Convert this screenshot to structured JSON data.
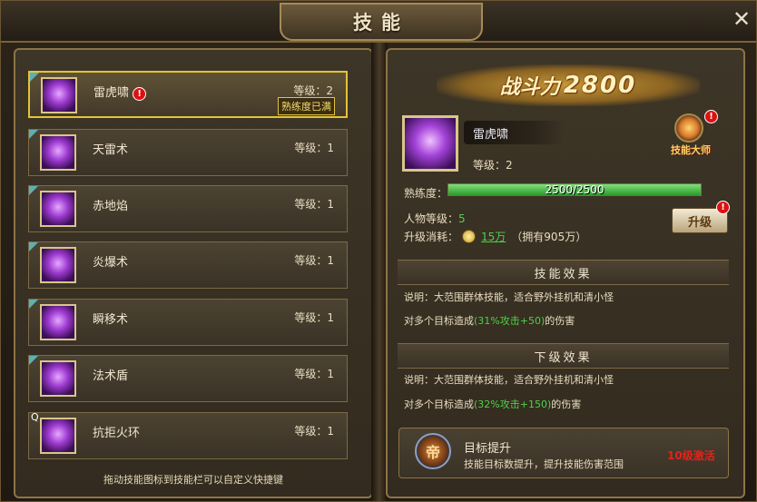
{
  "window": {
    "title": "技能",
    "close_label": "✕"
  },
  "skills": [
    {
      "name": "雷虎啸",
      "level_label": "等级：2",
      "selected": true,
      "alert": "!",
      "badge": "熟练度已满",
      "hotkey": ""
    },
    {
      "name": "天雷术",
      "level_label": "等级：1",
      "selected": false,
      "hotkey": ""
    },
    {
      "name": "赤地焰",
      "level_label": "等级：1",
      "selected": false,
      "hotkey": ""
    },
    {
      "name": "炎爆术",
      "level_label": "等级：1",
      "selected": false,
      "hotkey": ""
    },
    {
      "name": "瞬移术",
      "level_label": "等级：1",
      "selected": false,
      "hotkey": ""
    },
    {
      "name": "法术盾",
      "level_label": "等级：1",
      "selected": false,
      "hotkey": ""
    },
    {
      "name": "抗拒火环",
      "level_label": "等级：1",
      "selected": false,
      "hotkey": "Q"
    }
  ],
  "hint": "拖动技能图标到技能栏可以自定义快捷键",
  "detail": {
    "power_label": "战斗力",
    "power_value": "2800",
    "skill_name": "雷虎啸",
    "skill_level": "等级：2",
    "master_label": "技能大师",
    "master_alert": "!",
    "proficiency_label": "熟练度：",
    "proficiency_text": "2500/2500",
    "proficiency_ratio": 1.0,
    "char_level_label": "人物等级：",
    "char_level_value": "5",
    "cost_label": "升级消耗：",
    "cost_value": "15万",
    "cost_owned": "（拥有905万）",
    "upgrade_label": "升级",
    "upgrade_alert": "!"
  },
  "current_effect": {
    "title": "技能效果",
    "desc": "说明：大范围群体技能，适合野外挂机和清小怪",
    "damage_prefix": "对多个目标造成",
    "damage_value": "(31%攻击+50)",
    "damage_suffix": "的伤害"
  },
  "next_effect": {
    "title": "下级效果",
    "desc": "说明：大范围群体技能，适合野外挂机和清小怪",
    "damage_prefix": "对多个目标造成",
    "damage_value": "(32%攻击+150)",
    "damage_suffix": "的伤害"
  },
  "target_upgrade": {
    "icon_glyph": "帝",
    "title": "目标提升",
    "desc": "技能目标数提升，提升技能伤害范围",
    "requirement": "10级激活"
  }
}
